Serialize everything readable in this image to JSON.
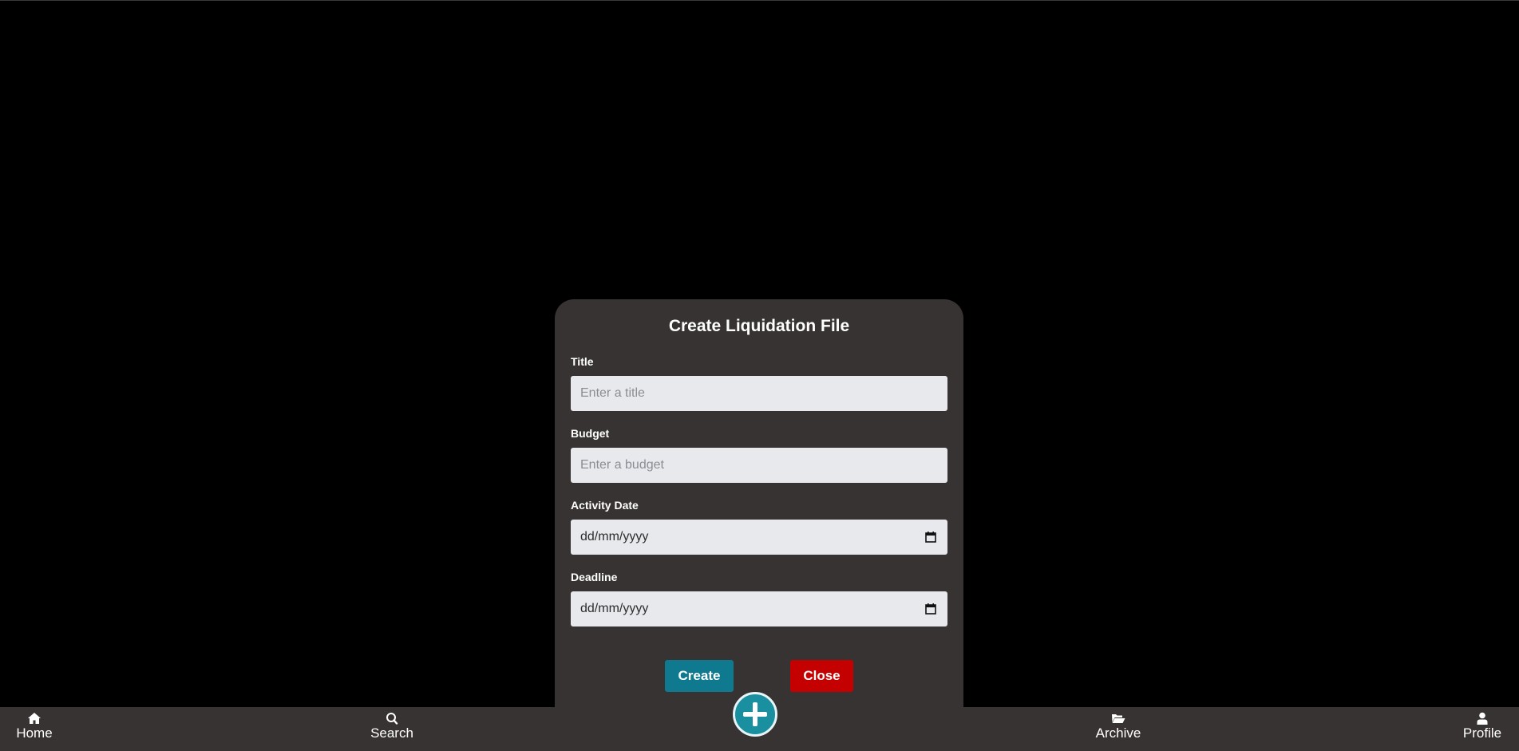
{
  "modal": {
    "title": "Create Liquidation File",
    "fields": [
      {
        "label": "Title",
        "placeholder": "Enter a title",
        "value": ""
      },
      {
        "label": "Budget",
        "placeholder": "Enter a budget",
        "value": ""
      },
      {
        "label": "Activity Date",
        "display": "dd/mm/yyyy"
      },
      {
        "label": "Deadline",
        "display": "dd/mm/yyyy"
      }
    ],
    "create_label": "Create",
    "close_label": "Close"
  },
  "nav": {
    "items": [
      {
        "label": "Home",
        "icon": "home-icon"
      },
      {
        "label": "Search",
        "icon": "search-icon"
      },
      {
        "label": "Archive",
        "icon": "folder-open-icon"
      },
      {
        "label": "Profile",
        "icon": "user-icon"
      }
    ],
    "fab_icon": "plus-icon"
  },
  "colors": {
    "background": "#000000",
    "panel": "#383333",
    "input": "#e8e9ec",
    "create": "#0f7a8f",
    "close": "#c40000",
    "fab": "#1a8fa0"
  }
}
